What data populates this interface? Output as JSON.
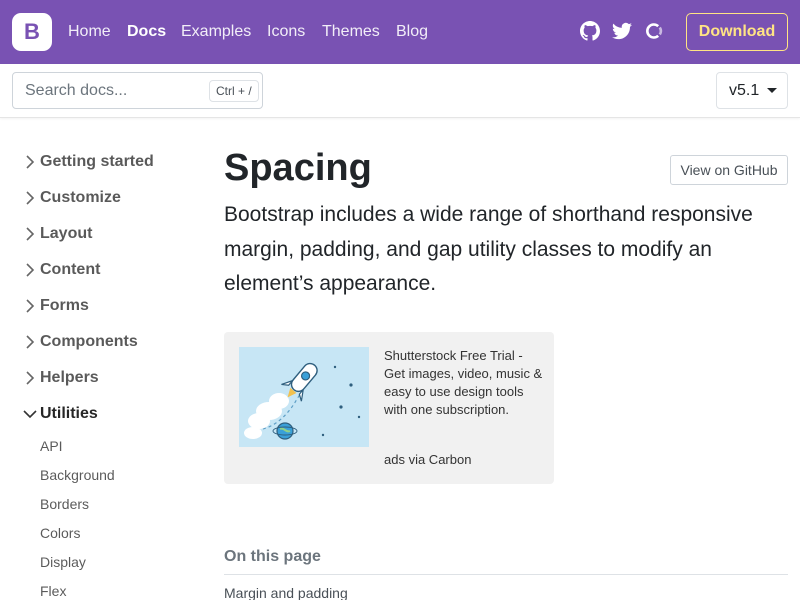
{
  "navbar": {
    "brand_letter": "B",
    "links": [
      "Home",
      "Docs",
      "Examples",
      "Icons",
      "Themes",
      "Blog"
    ],
    "active_link": "Docs",
    "icons": [
      "github-icon",
      "twitter-icon",
      "opencollective-icon"
    ],
    "download_label": "Download",
    "background_color": "#7952b3",
    "download_color": "#ffe484"
  },
  "search": {
    "placeholder": "Search docs...",
    "shortcut": "Ctrl + /"
  },
  "version": {
    "label": "v5.1"
  },
  "sidebar": {
    "sections": [
      {
        "label": "Getting started",
        "expanded": false
      },
      {
        "label": "Customize",
        "expanded": false
      },
      {
        "label": "Layout",
        "expanded": false
      },
      {
        "label": "Content",
        "expanded": false
      },
      {
        "label": "Forms",
        "expanded": false
      },
      {
        "label": "Components",
        "expanded": false
      },
      {
        "label": "Helpers",
        "expanded": false
      },
      {
        "label": "Utilities",
        "expanded": true
      }
    ],
    "utilities_items": [
      "API",
      "Background",
      "Borders",
      "Colors",
      "Display",
      "Flex"
    ]
  },
  "main": {
    "title": "Spacing",
    "github_button": "View on GitHub",
    "lead": "Bootstrap includes a wide range of shorthand responsive margin, padding, and gap utility classes to modify an element’s appearance.",
    "ad": {
      "text": "Shutterstock Free Trial - Get images, video, music & easy to use design tools with one subscription.",
      "via": "ads via Carbon"
    },
    "toc": {
      "title": "On this page",
      "items": [
        "Margin and padding"
      ]
    }
  }
}
